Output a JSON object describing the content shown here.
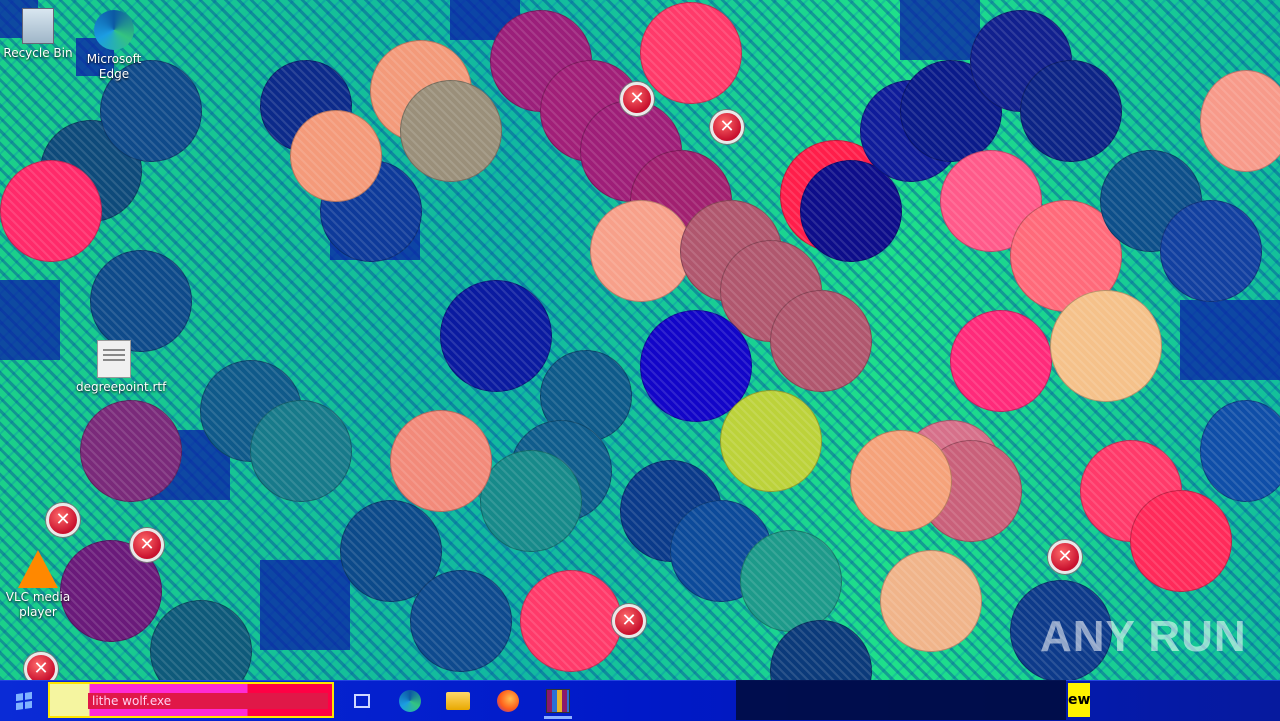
{
  "desktop": {
    "icons": [
      {
        "label": "Recycle Bin",
        "glyph": "recycle-bin-icon"
      },
      {
        "label": "Microsoft Edge",
        "glyph": "edge-icon"
      },
      {
        "label": "degreepoint.rtf",
        "glyph": "document-icon"
      },
      {
        "label": "VLC media player",
        "glyph": "vlc-icon"
      }
    ],
    "watermark": "ANY RUN"
  },
  "taskbar": {
    "search_text": "lithe wolf.exe",
    "tray_label": "ewi",
    "apps": [
      "task-view-icon",
      "edge-icon",
      "file-explorer-icon",
      "firefox-icon",
      "winrar-icon"
    ]
  },
  "colors": {
    "taskbar": "#0019c8",
    "desktop_base": "#1fd98b",
    "error_red": "#c8102e"
  }
}
